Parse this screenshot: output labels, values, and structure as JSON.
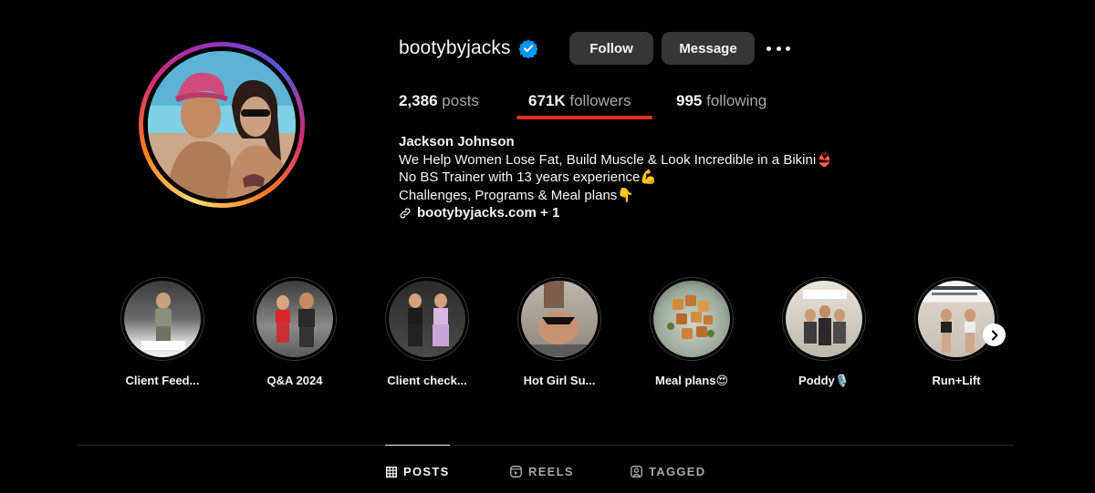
{
  "profile": {
    "username": "bootybyjacks",
    "verified_icon": "verified-badge-icon",
    "follow_label": "Follow",
    "message_label": "Message",
    "more_icon": "more-options-icon"
  },
  "stats": {
    "posts_count": "2,386",
    "posts_label": "posts",
    "followers_count": "671K",
    "followers_label": "followers",
    "following_count": "995",
    "following_label": "following",
    "highlight_underline_color": "#e0321f"
  },
  "bio": {
    "name": "Jackson Johnson",
    "line1": "We Help Women Lose Fat, Build Muscle & Look Incredible in a Bikini👙",
    "line2": "No BS Trainer with 13 years experience💪",
    "line3": "Challenges, Programs & Meal plans👇",
    "link_text": "bootybyjacks.com + 1"
  },
  "highlights": [
    {
      "label": "Client Feed..."
    },
    {
      "label": "Q&A 2024"
    },
    {
      "label": "Client check..."
    },
    {
      "label": "Hot Girl Su..."
    },
    {
      "label": "Meal plans😍"
    },
    {
      "label": "Poddy🎙️"
    },
    {
      "label": "Run+Lift"
    }
  ],
  "tabs": {
    "posts": "POSTS",
    "reels": "REELS",
    "tagged": "TAGGED"
  },
  "colors": {
    "background": "#000000",
    "button_bg": "#363636",
    "verified": "#0095f6",
    "muted_text": "#a8a8a8"
  }
}
